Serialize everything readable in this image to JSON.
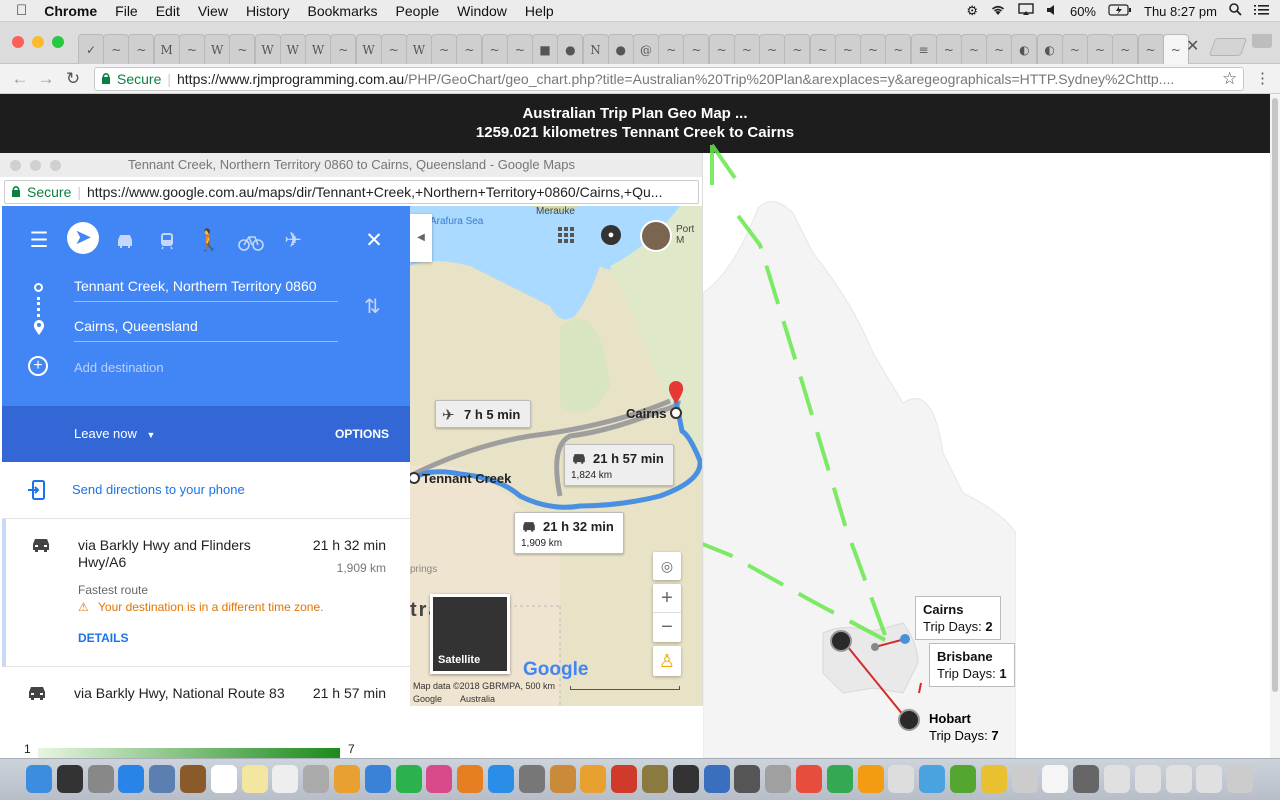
{
  "menubar": {
    "app": "Chrome",
    "items": [
      "File",
      "Edit",
      "View",
      "History",
      "Bookmarks",
      "People",
      "Window",
      "Help"
    ],
    "battery": "60%",
    "clock": "Thu 8:27 pm"
  },
  "browser": {
    "secure_label": "Secure",
    "url_main": "https://www.rjmprogramming.com.au",
    "url_rest": "/PHP/GeoChart/geo_chart.php?title=Australian%20Trip%20Plan&arexplaces=y&aregeographicals=HTTP.Sydney%2Chttp...."
  },
  "page": {
    "title": "Australian Trip Plan Geo Map ...",
    "subtitle": "1259.021 kilometres Tennant Creek to Cairns"
  },
  "maps_window": {
    "title": "Tennant Creek, Northern Territory 0860 to Cairns, Queensland - Google Maps",
    "secure_label": "Secure",
    "url": "https://www.google.com.au/maps/dir/Tennant+Creek,+Northern+Territory+0860/Cairns,+Qu..."
  },
  "directions": {
    "origin": "Tennant Creek, Northern Territory 0860",
    "destination": "Cairns, Queensland",
    "add_destination": "Add destination",
    "leave_now": "Leave now",
    "options": "OPTIONS",
    "send": "Send directions to your phone",
    "routes": [
      {
        "title": "via Barkly Hwy and Flinders Hwy/A6",
        "time": "21 h 32 min",
        "distance": "1,909 km",
        "fastest": "Fastest route",
        "warning": "Your destination is in a different time zone.",
        "details": "DETAILS"
      },
      {
        "title": "via Barkly Hwy, National Route 83",
        "time": "21 h 57 min"
      }
    ]
  },
  "map": {
    "sea_label": "Arafura Sea",
    "town_label": "Merauke",
    "port_label": "Port M",
    "cairns": "Cairns",
    "tennant": "Tennant Creek",
    "flight_time": "7 h 5 min",
    "route_alt_time": "21 h 57 min",
    "route_alt_dist": "1,824 km",
    "route_main_time": "21 h 32 min",
    "route_main_dist": "1,909 km",
    "springs": "prings",
    "tra": "tra",
    "satellite": "Satellite",
    "google": "Google",
    "attribution": "Map data ©2018 GBRMPA, 500 km",
    "footer_google": "Google",
    "footer_australia": "Australia"
  },
  "geo": {
    "places": [
      {
        "name": "Cairns",
        "days_label": "Trip Days:",
        "days": "2"
      },
      {
        "name": "Brisbane",
        "days_label": "Trip Days:",
        "days": "1"
      },
      {
        "name": "Hobart",
        "days_label": "Trip Days:",
        "days": "7"
      }
    ]
  },
  "legend": {
    "min": "1",
    "max": "7"
  },
  "colors": {
    "maps_blue": "#4285f4",
    "maps_blue_dark": "#3367d6",
    "route_blue": "#4a90e2",
    "arrow_green": "#66e84a",
    "trip_red": "#d62a2a"
  }
}
